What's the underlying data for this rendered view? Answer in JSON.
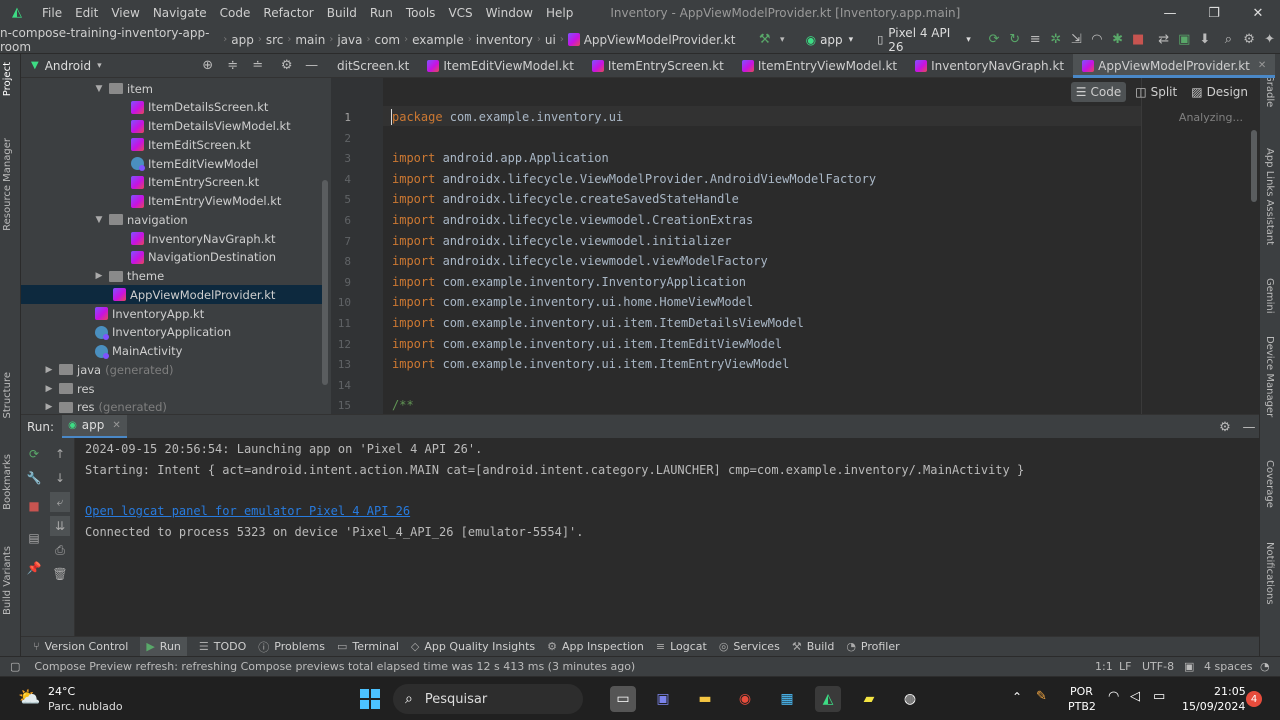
{
  "titlebar": {
    "menu": [
      "File",
      "Edit",
      "View",
      "Navigate",
      "Code",
      "Refactor",
      "Build",
      "Run",
      "Tools",
      "VCS",
      "Window",
      "Help"
    ],
    "window_title": "Inventory - AppViewModelProvider.kt [Inventory.app.main]"
  },
  "navbar": {
    "breadcrumbs": [
      "n-compose-training-inventory-app-room",
      "app",
      "src",
      "main",
      "java",
      "com",
      "example",
      "inventory",
      "ui",
      "AppViewModelProvider.kt"
    ],
    "run_config": "app",
    "device": "Pixel 4 API 26"
  },
  "project": {
    "view_label": "Android",
    "tree": [
      {
        "label": "item",
        "type": "folder",
        "expanded": true
      },
      {
        "label": "ItemDetailsScreen.kt",
        "type": "kt"
      },
      {
        "label": "ItemDetailsViewModel.kt",
        "type": "kt"
      },
      {
        "label": "ItemEditScreen.kt",
        "type": "kt"
      },
      {
        "label": "ItemEditViewModel",
        "type": "class"
      },
      {
        "label": "ItemEntryScreen.kt",
        "type": "kt"
      },
      {
        "label": "ItemEntryViewModel.kt",
        "type": "kt"
      },
      {
        "label": "navigation",
        "type": "folder",
        "expanded": true
      },
      {
        "label": "InventoryNavGraph.kt",
        "type": "kt"
      },
      {
        "label": "NavigationDestination",
        "type": "kt"
      },
      {
        "label": "theme",
        "type": "folder",
        "expanded": false
      },
      {
        "label": "AppViewModelProvider.kt",
        "type": "kt",
        "selected": true
      },
      {
        "label": "InventoryApp.kt",
        "type": "kt"
      },
      {
        "label": "InventoryApplication",
        "type": "class"
      },
      {
        "label": "MainActivity",
        "type": "class"
      },
      {
        "label": "java",
        "type": "folder",
        "suffix": "(generated)"
      },
      {
        "label": "res",
        "type": "folder"
      },
      {
        "label": "res",
        "type": "folder",
        "suffix": "(generated)"
      }
    ]
  },
  "tabs": [
    "ditScreen.kt",
    "ItemEditViewModel.kt",
    "ItemEntryScreen.kt",
    "ItemEntryViewModel.kt",
    "InventoryNavGraph.kt",
    "AppViewModelProvider.kt"
  ],
  "editor": {
    "view_modes": [
      "Code",
      "Split",
      "Design"
    ],
    "status": "Analyzing...",
    "lines": [
      {
        "n": "1",
        "kw": "package",
        "rest": " com.example.inventory.ui"
      },
      {
        "n": "2",
        "kw": "",
        "rest": ""
      },
      {
        "n": "3",
        "kw": "import",
        "rest": " android.app.Application"
      },
      {
        "n": "4",
        "kw": "import",
        "rest": " androidx.lifecycle.ViewModelProvider.AndroidViewModelFactory"
      },
      {
        "n": "5",
        "kw": "import",
        "rest": " androidx.lifecycle.createSavedStateHandle"
      },
      {
        "n": "6",
        "kw": "import",
        "rest": " androidx.lifecycle.viewmodel.CreationExtras"
      },
      {
        "n": "7",
        "kw": "import",
        "rest": " androidx.lifecycle.viewmodel.initializer"
      },
      {
        "n": "8",
        "kw": "import",
        "rest": " androidx.lifecycle.viewmodel.viewModelFactory"
      },
      {
        "n": "9",
        "kw": "import",
        "rest": " com.example.inventory.InventoryApplication"
      },
      {
        "n": "10",
        "kw": "import",
        "rest": " com.example.inventory.ui.home.HomeViewModel"
      },
      {
        "n": "11",
        "kw": "import",
        "rest": " com.example.inventory.ui.item.ItemDetailsViewModel"
      },
      {
        "n": "12",
        "kw": "import",
        "rest": " com.example.inventory.ui.item.ItemEditViewModel"
      },
      {
        "n": "13",
        "kw": "import",
        "rest": " com.example.inventory.ui.item.ItemEntryViewModel"
      },
      {
        "n": "14",
        "kw": "",
        "rest": ""
      },
      {
        "n": "15",
        "kw": "",
        "rest": "/**",
        "comment": true
      }
    ]
  },
  "run": {
    "label": "Run:",
    "config": "app",
    "console": [
      "2024-09-15 20:56:54: Launching app on 'Pixel 4 API 26'.",
      "Starting: Intent { act=android.intent.action.MAIN cat=[android.intent.category.LAUNCHER] cmp=com.example.inventory/.MainActivity }",
      "",
      "Open logcat panel for emulator Pixel 4 API 26",
      "Connected to process 5323 on device 'Pixel_4_API_26 [emulator-5554]'."
    ]
  },
  "left_strip": [
    "Project",
    "Resource Manager",
    "Structure",
    "Bookmarks",
    "Build Variants"
  ],
  "right_strip": [
    "Gradle",
    "App Links Assistant",
    "Gemini",
    "Device Manager",
    "Coverage",
    "Notifications"
  ],
  "bottom_tools": [
    "Version Control",
    "Run",
    "TODO",
    "Problems",
    "Terminal",
    "App Quality Insights",
    "App Inspection",
    "Logcat",
    "Services",
    "Build",
    "Profiler"
  ],
  "statusbar": {
    "message": "Compose Preview refresh: refreshing Compose previews total elapsed time was 12 s 413 ms (3 minutes ago)",
    "position": "1:1",
    "line_sep": "LF",
    "encoding": "UTF-8",
    "indent": "4 spaces"
  },
  "taskbar": {
    "temperature": "24°C",
    "weather": "Parc. nublado",
    "search": "Pesquisar",
    "lang": "POR",
    "kbd": "PTB2",
    "time": "21:05",
    "date": "15/09/2024",
    "notif_count": "4"
  }
}
